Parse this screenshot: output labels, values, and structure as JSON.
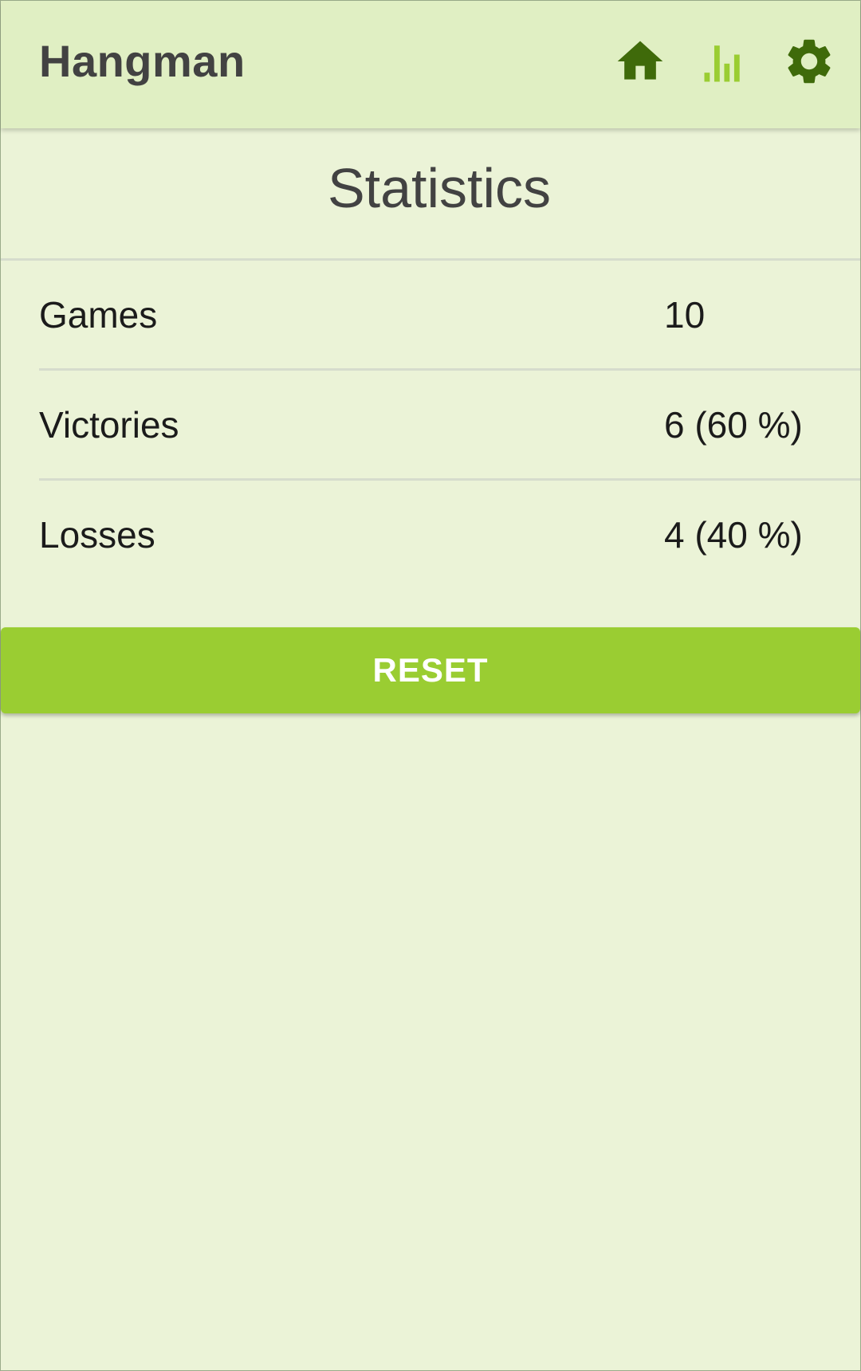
{
  "appbar": {
    "title": "Hangman",
    "icons": {
      "home": "home-icon",
      "stats": "bar-chart-icon",
      "settings": "gear-icon"
    },
    "colors": {
      "background": "#e0efc3",
      "icon_dark": "#3f6a0a",
      "icon_active": "#9acd32"
    }
  },
  "statistics": {
    "title": "Statistics",
    "rows": [
      {
        "label": "Games",
        "value": "10"
      },
      {
        "label": "Victories",
        "value": "6 (60 %)"
      },
      {
        "label": "Losses",
        "value": "4 (40 %)"
      }
    ]
  },
  "actions": {
    "reset_label": "RESET"
  },
  "colors": {
    "page_background": "#ebf3d7",
    "accent": "#9acd32",
    "text": "#1b1b1b",
    "title_text": "#424242"
  }
}
